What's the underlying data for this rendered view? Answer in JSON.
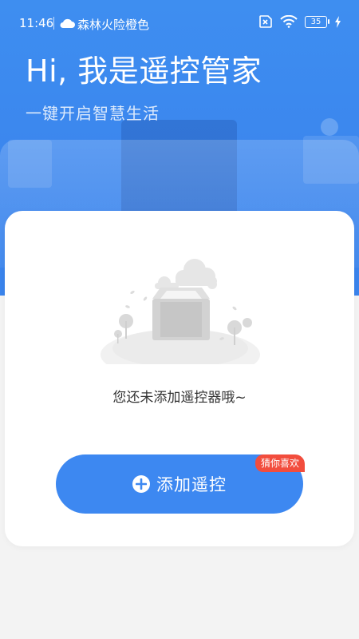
{
  "status_bar": {
    "time": "11:46",
    "weather_text": "森林火险橙色",
    "battery": "35",
    "icons": [
      "weather-cloud-icon",
      "sim-x-icon",
      "wifi-icon",
      "battery-icon",
      "charging-icon"
    ]
  },
  "hero": {
    "greeting": "Hi, 我是遥控管家",
    "subtitle": "一键开启智慧生活"
  },
  "card": {
    "empty_message": "您还未添加遥控器哦~",
    "add_button_label": "添加遥控",
    "badge": "猜你喜欢"
  },
  "colors": {
    "primary": "#3d88f1",
    "badge": "#f24d3d",
    "background": "#f3f3f3"
  }
}
